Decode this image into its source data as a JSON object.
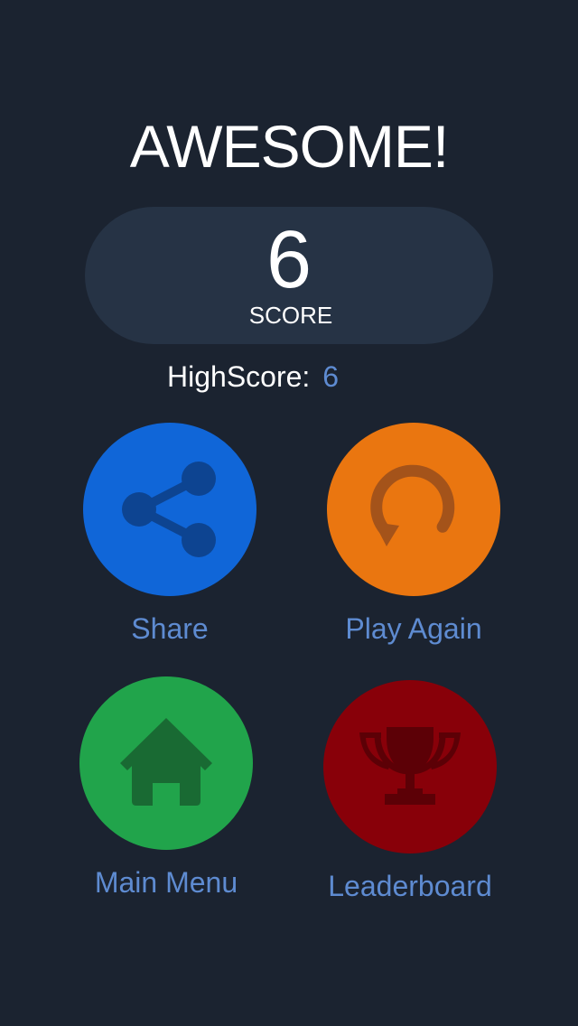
{
  "header": {
    "title": "AWESOME!"
  },
  "score": {
    "value": "6",
    "label": "SCORE"
  },
  "highscore": {
    "label": "HighScore:",
    "value": "6"
  },
  "buttons": {
    "share": {
      "label": "Share",
      "icon": "share-icon",
      "color": "#1066d8"
    },
    "play_again": {
      "label": "Play Again",
      "icon": "replay-icon",
      "color": "#ea7610"
    },
    "main_menu": {
      "label": "Main Menu",
      "icon": "home-icon",
      "color": "#21a44b"
    },
    "leaderboard": {
      "label": "Leaderboard",
      "icon": "trophy-icon",
      "color": "#880009"
    }
  },
  "colors": {
    "background": "#1b2330",
    "score_pill": "#263345",
    "label_text": "#5e8bd1"
  }
}
